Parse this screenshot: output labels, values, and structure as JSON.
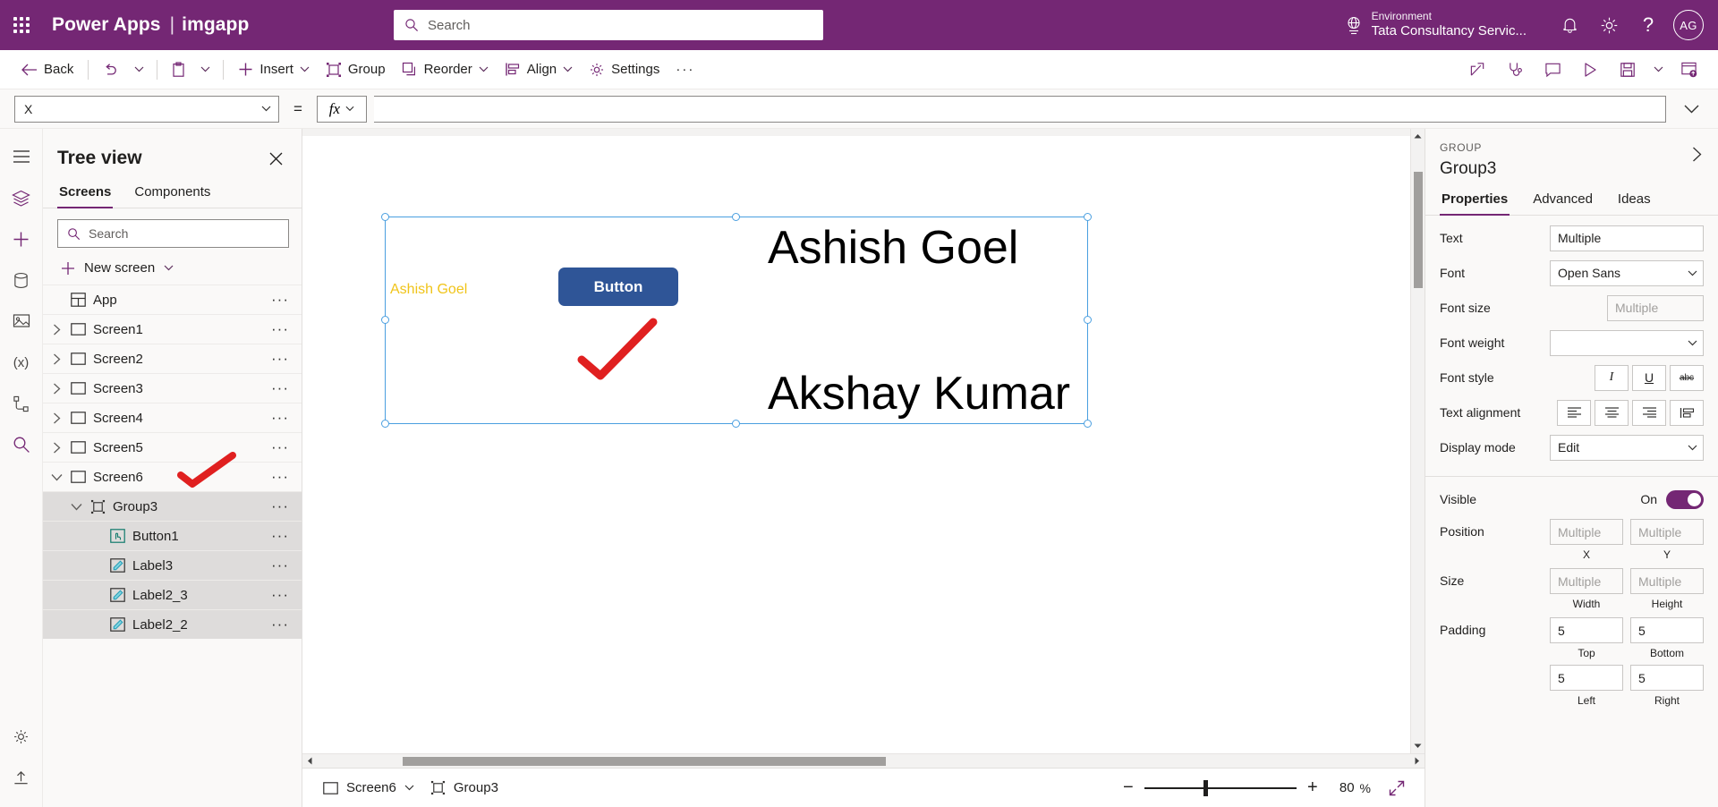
{
  "topbar": {
    "waffle": "app-launcher",
    "brand": "Power Apps",
    "separator": "|",
    "app_name": "imgapp",
    "search_placeholder": "Search",
    "environment_label": "Environment",
    "environment_value": "Tata Consultancy Servic...",
    "avatar_initials": "AG",
    "accent": "#742774"
  },
  "commandbar": {
    "back": "Back",
    "insert": "Insert",
    "group": "Group",
    "reorder": "Reorder",
    "align": "Align",
    "settings": "Settings",
    "overflow": "···"
  },
  "formulabar": {
    "property": "X",
    "equals": "=",
    "fx": "fx",
    "value": ""
  },
  "treeview": {
    "title": "Tree view",
    "tabs": [
      {
        "label": "Screens",
        "active": true
      },
      {
        "label": "Components",
        "active": false
      }
    ],
    "search_placeholder": "Search",
    "new_screen": "New screen",
    "items": [
      {
        "label": "App",
        "icon": "app-icon",
        "indent": 0,
        "chevron": "none",
        "selected": false
      },
      {
        "label": "Screen1",
        "icon": "screen-icon",
        "indent": 0,
        "chevron": "collapsed",
        "selected": false
      },
      {
        "label": "Screen2",
        "icon": "screen-icon",
        "indent": 0,
        "chevron": "collapsed",
        "selected": false
      },
      {
        "label": "Screen3",
        "icon": "screen-icon",
        "indent": 0,
        "chevron": "collapsed",
        "selected": false
      },
      {
        "label": "Screen4",
        "icon": "screen-icon",
        "indent": 0,
        "chevron": "collapsed",
        "selected": false
      },
      {
        "label": "Screen5",
        "icon": "screen-icon",
        "indent": 0,
        "chevron": "collapsed",
        "selected": false
      },
      {
        "label": "Screen6",
        "icon": "screen-icon",
        "indent": 0,
        "chevron": "expanded",
        "selected": false
      },
      {
        "label": "Group3",
        "icon": "group-icon",
        "indent": 1,
        "chevron": "expanded",
        "selected": true
      },
      {
        "label": "Button1",
        "icon": "button-icon",
        "indent": 2,
        "chevron": "none",
        "selected": true
      },
      {
        "label": "Label3",
        "icon": "label-icon",
        "indent": 2,
        "chevron": "none",
        "selected": true
      },
      {
        "label": "Label2_3",
        "icon": "label-icon",
        "indent": 2,
        "chevron": "none",
        "selected": true
      },
      {
        "label": "Label2_2",
        "icon": "label-icon",
        "indent": 2,
        "chevron": "none",
        "selected": true
      }
    ],
    "row_menu": "···"
  },
  "canvas": {
    "label_small": "Ashish Goel",
    "label_small_color": "#f0c419",
    "button_text": "Button",
    "button_color": "#2f5597",
    "label_big_1": "Ashish Goel",
    "label_big_2": "Akshay Kumar",
    "selection_color": "#4a9fe0"
  },
  "statusbar": {
    "screen": "Screen6",
    "breadcrumb": "Group3",
    "zoom_out": "−",
    "zoom_in": "+",
    "zoom_value": "80",
    "zoom_unit": "%"
  },
  "properties": {
    "kind": "GROUP",
    "name": "Group3",
    "tabs": [
      {
        "label": "Properties",
        "active": true
      },
      {
        "label": "Advanced",
        "active": false
      },
      {
        "label": "Ideas",
        "active": false
      }
    ],
    "text_label": "Text",
    "text_value": "Multiple",
    "font_label": "Font",
    "font_value": "Open Sans",
    "font_size_label": "Font size",
    "font_size_value": "Multiple",
    "font_weight_label": "Font weight",
    "font_weight_value": "",
    "font_style_label": "Font style",
    "font_style_buttons": [
      "I",
      "U",
      "abc"
    ],
    "text_alignment_label": "Text alignment",
    "display_mode_label": "Display mode",
    "display_mode_value": "Edit",
    "visible_label": "Visible",
    "visible_state": "On",
    "position_label": "Position",
    "position_x": "Multiple",
    "position_y": "Multiple",
    "position_x_cap": "X",
    "position_y_cap": "Y",
    "size_label": "Size",
    "size_w": "Multiple",
    "size_h": "Multiple",
    "size_w_cap": "Width",
    "size_h_cap": "Height",
    "padding_label": "Padding",
    "padding_top": "5",
    "padding_bottom": "5",
    "padding_left": "5",
    "padding_right": "5",
    "padding_top_cap": "Top",
    "padding_bottom_cap": "Bottom",
    "padding_left_cap": "Left",
    "padding_right_cap": "Right"
  }
}
